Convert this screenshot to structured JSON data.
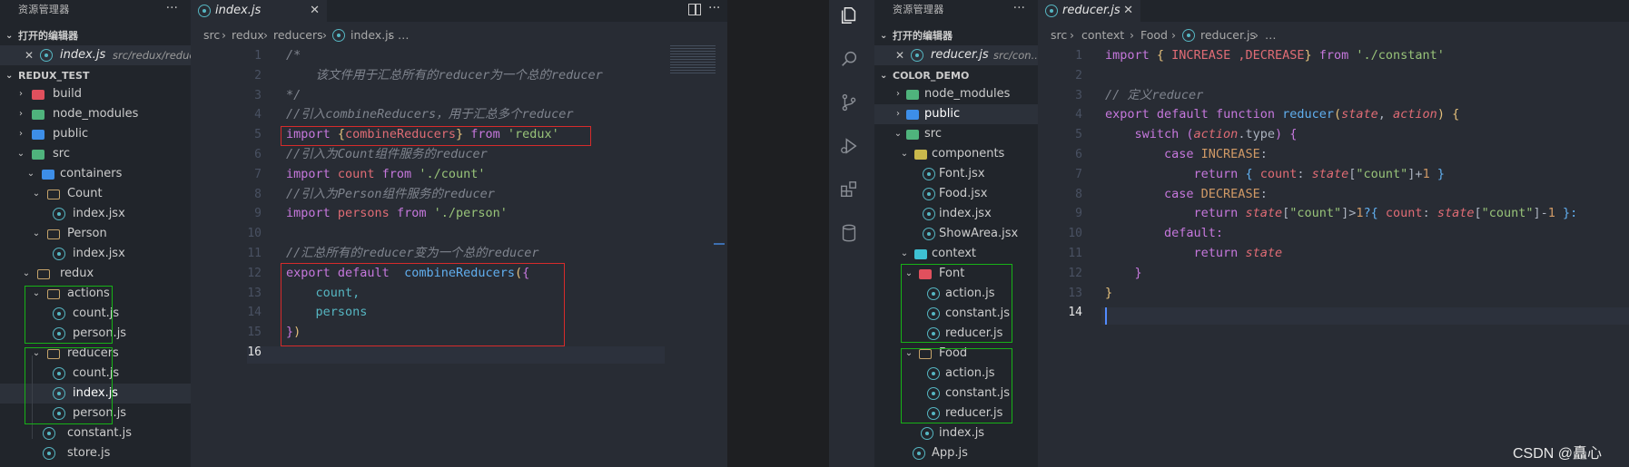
{
  "left": {
    "explorer_title": "资源管理器",
    "open_editors_label": "打开的编辑器",
    "open_editor": {
      "name": "index.js",
      "path": "src/redux/reducers"
    },
    "project_label": "REDUX_TEST",
    "tree": [
      {
        "label": "build"
      },
      {
        "label": "node_modules"
      },
      {
        "label": "public"
      },
      {
        "label": "src"
      },
      {
        "label": "containers"
      },
      {
        "label": "Count"
      },
      {
        "label": "index.jsx"
      },
      {
        "label": "Person"
      },
      {
        "label": "index.jsx"
      },
      {
        "label": "redux"
      },
      {
        "label": "actions"
      },
      {
        "label": "count.js"
      },
      {
        "label": "person.js"
      },
      {
        "label": "reducers"
      },
      {
        "label": "count.js"
      },
      {
        "label": "index.js"
      },
      {
        "label": "person.js"
      },
      {
        "label": "constant.js"
      },
      {
        "label": "store.js"
      }
    ],
    "tab": "index.js",
    "breadcrumb": [
      "src",
      "redux",
      "reducers",
      "index.js",
      "…"
    ],
    "line_numbers": [
      "1",
      "2",
      "3",
      "4",
      "5",
      "6",
      "7",
      "8",
      "9",
      "10",
      "11",
      "12",
      "13",
      "14",
      "15",
      "16"
    ],
    "code": {
      "l1": "/*",
      "l2": "    该文件用于汇总所有的reducer为一个总的reducer",
      "l3": "*/",
      "l4": "//引入combineReducers，用于汇总多个reducer",
      "l5a": "import ",
      "l5b": "{",
      "l5c": "combineReducers",
      "l5d": "}",
      "l5e": " from ",
      "l5f": "'redux'",
      "l6": "//引入为Count组件服务的reducer",
      "l7a": "import ",
      "l7b": "count",
      "l7c": " from ",
      "l7d": "'./count'",
      "l8": "//引入为Person组件服务的reducer",
      "l9a": "import ",
      "l9b": "persons",
      "l9c": " from ",
      "l9d": "'./person'",
      "l11": "//汇总所有的reducer变为一个总的reducer",
      "l12a": "export ",
      "l12b": "default ",
      "l12c": " combineReducers",
      "l12d": "(",
      "l12e": "{",
      "l13": "    count,",
      "l14": "    persons",
      "l15a": "}",
      "l15b": ")"
    }
  },
  "activity": [
    "files-icon",
    "search-icon",
    "source-control-icon",
    "run-debug-icon",
    "extensions-icon",
    "database-icon"
  ],
  "right": {
    "explorer_title": "资源管理器",
    "open_editors_label": "打开的编辑器",
    "open_editor": {
      "name": "reducer.js",
      "path": "src/con..."
    },
    "project_label": "COLOR_DEMO",
    "tree": [
      {
        "label": "node_modules"
      },
      {
        "label": "public"
      },
      {
        "label": "src"
      },
      {
        "label": "components"
      },
      {
        "label": "Font.jsx"
      },
      {
        "label": "Food.jsx"
      },
      {
        "label": "index.jsx"
      },
      {
        "label": "ShowArea.jsx"
      },
      {
        "label": "context"
      },
      {
        "label": "Font"
      },
      {
        "label": "action.js"
      },
      {
        "label": "constant.js"
      },
      {
        "label": "reducer.js"
      },
      {
        "label": "Food"
      },
      {
        "label": "action.js"
      },
      {
        "label": "constant.js"
      },
      {
        "label": "reducer.js"
      },
      {
        "label": "index.js"
      },
      {
        "label": "App.js"
      }
    ],
    "tab": "reducer.js",
    "breadcrumb": [
      "src",
      "context",
      "Food",
      "reducer.js",
      "…"
    ],
    "line_numbers": [
      "1",
      "2",
      "3",
      "4",
      "5",
      "6",
      "7",
      "8",
      "9",
      "10",
      "11",
      "12",
      "13",
      "14"
    ],
    "code": {
      "l1a": "import ",
      "l1b": "{ ",
      "l1c": "INCREASE ,DECREASE",
      "l1d": "}",
      "l1e": " from ",
      "l1f": "'./constant'",
      "l3": "// 定义reducer",
      "l4a": "export ",
      "l4b": "default ",
      "l4c": "function ",
      "l4d": "reducer",
      "l4e": "(",
      "l4f": "state",
      "l4g": ", ",
      "l4h": "action",
      "l4i": ") ",
      "l4j": "{",
      "l5a": "    switch ",
      "l5b": "(",
      "l5c": "action",
      "l5d": ".type",
      "l5e": ") ",
      "l5f": "{",
      "l6a": "        case ",
      "l6b": "INCREASE",
      "l6c": ":",
      "l7a": "            return ",
      "l7b": "{ ",
      "l7c": "count",
      "l7d": ": ",
      "l7e": "state",
      "l7f": "[",
      "l7g": "\"count\"",
      "l7h": "]+",
      "l7i": "1",
      "l7j": " }",
      "l8a": "        case ",
      "l8b": "DECREASE",
      "l8c": ":",
      "l9a": "            return ",
      "l9b": "state",
      "l9c": "[",
      "l9d": "\"count\"",
      "l9e": "]>",
      "l9f": "1",
      "l9g": "?{ ",
      "l9h": "count",
      "l9i": ": ",
      "l9j": "state",
      "l9k": "[",
      "l9l": "\"count\"",
      "l9m": "]-",
      "l9n": "1",
      "l9o": " }:",
      "l10": "        default:",
      "l11a": "            return ",
      "l11b": "state",
      "l12": "    }",
      "l13": "}"
    }
  },
  "watermark": "CSDN @矗心"
}
